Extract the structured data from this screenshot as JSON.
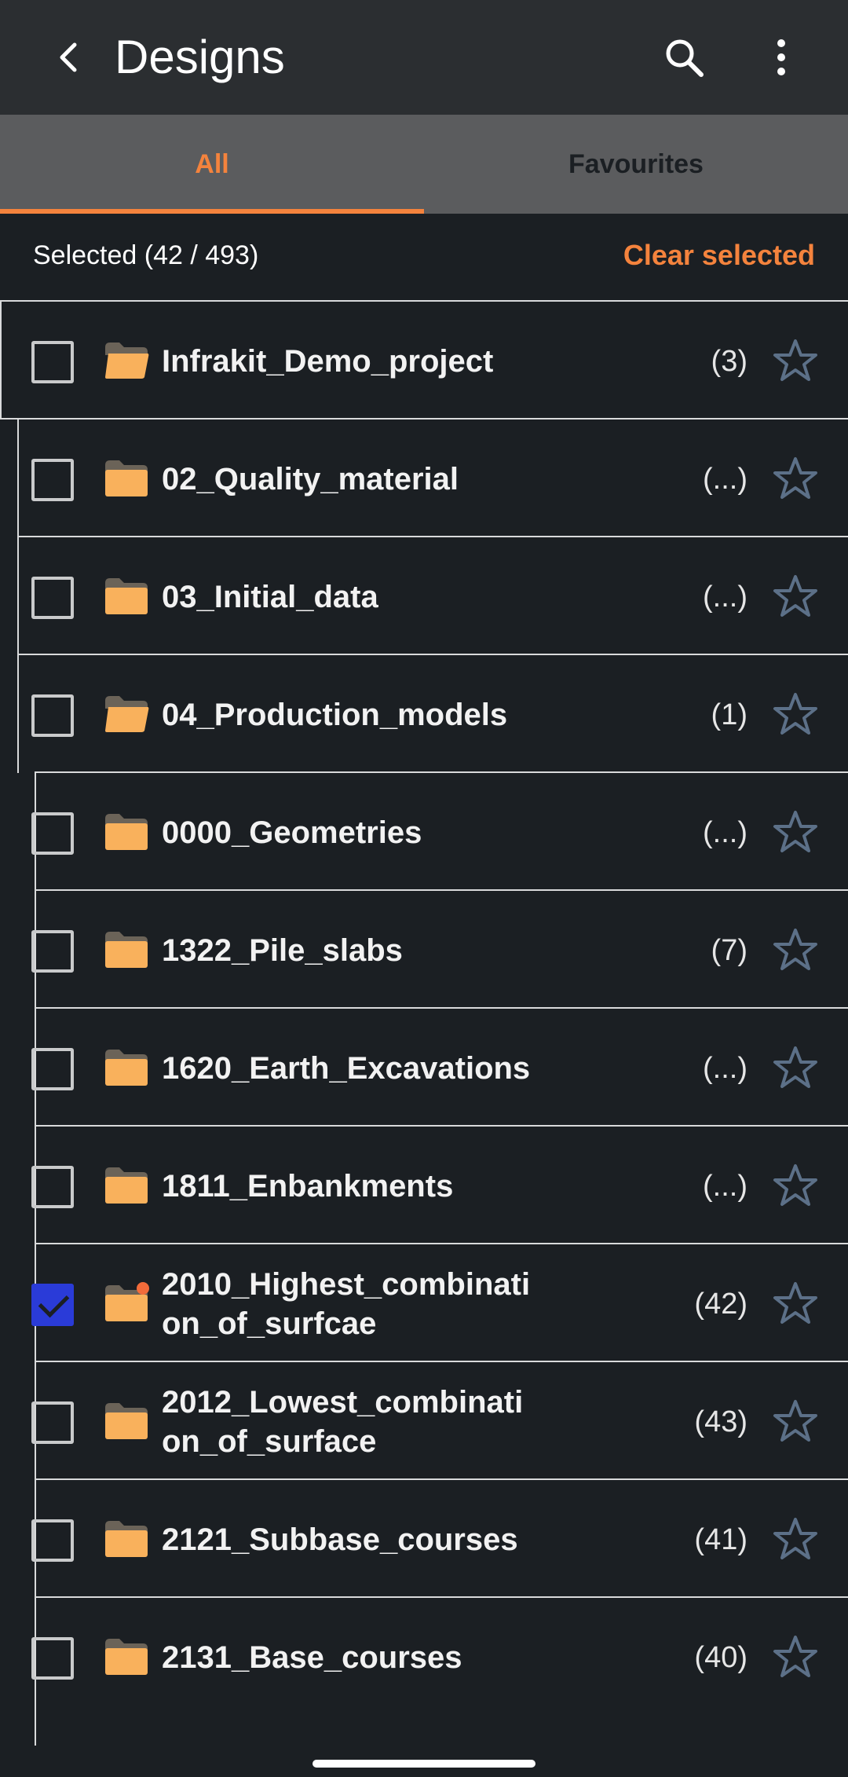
{
  "app_bar": {
    "title": "Designs"
  },
  "tabs": [
    {
      "label": "All",
      "active": true
    },
    {
      "label": "Favourites",
      "active": false
    }
  ],
  "selection": {
    "summary": "Selected (42 / 493)",
    "clear_label": "Clear selected"
  },
  "colors": {
    "accent": "#f4833d",
    "folder": "#f9b15c",
    "checked": "#2a3bd8",
    "star": "#5c7088",
    "badge": "#f26b3a"
  },
  "rows": [
    {
      "name": "Infrakit_Demo_project",
      "count": "(3)",
      "level": 0,
      "checked": false,
      "open": true
    },
    {
      "name": "02_Quality_material",
      "count": "(...)",
      "level": 1,
      "checked": false,
      "open": false
    },
    {
      "name": "03_Initial_data",
      "count": "(...)",
      "level": 1,
      "checked": false,
      "open": false
    },
    {
      "name": "04_Production_models",
      "count": "(1)",
      "level": 1,
      "checked": false,
      "open": true
    },
    {
      "name": "0000_Geometries",
      "count": "(...)",
      "level": 2,
      "checked": false,
      "open": false
    },
    {
      "name": "1322_Pile_slabs",
      "count": "(7)",
      "level": 2,
      "checked": false,
      "open": false
    },
    {
      "name": "1620_Earth_Excavations",
      "count": "(...)",
      "level": 2,
      "checked": false,
      "open": false
    },
    {
      "name": "1811_Enbankments",
      "count": "(...)",
      "level": 2,
      "checked": false,
      "open": false
    },
    {
      "name": "2010_Highest_combination_of_surfcae",
      "count": "(42)",
      "level": 2,
      "checked": true,
      "open": false,
      "badge": true
    },
    {
      "name": "2012_Lowest_combination_of_surface",
      "count": "(43)",
      "level": 2,
      "checked": false,
      "open": false
    },
    {
      "name": "2121_Subbase_courses",
      "count": "(41)",
      "level": 2,
      "checked": false,
      "open": false
    },
    {
      "name": "2131_Base_courses",
      "count": "(40)",
      "level": 2,
      "checked": false,
      "open": false
    }
  ]
}
